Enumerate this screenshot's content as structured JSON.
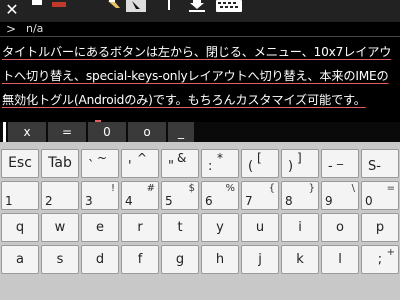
{
  "titlebar": {
    "close_glyph": "✕",
    "icons": [
      "close-icon",
      "menu-icon",
      "hand-icon",
      "cursor-icon",
      "vertical-bar-icon",
      "download-icon",
      "keyboard-icon"
    ]
  },
  "terminal": {
    "status_chevron": ">",
    "status_path": "n/a",
    "text": "タイトルバーにあるボタンは左から、閉じる、メニュー、10x7レイアウトへ切り替え、special-keys-onlyレイアウトへ切り替え、本来のIMEの無効化トグル(Androidのみ)です。もちろんカスタマイズ可能です。"
  },
  "candidates": [
    "x",
    "=",
    "0",
    "o",
    "_"
  ],
  "keyboard": {
    "row1": [
      {
        "main": "Esc"
      },
      {
        "main": "Tab"
      },
      {
        "lo": "`",
        "hi": "~"
      },
      {
        "lo": "'",
        "hi": "^"
      },
      {
        "lo": "\"",
        "hi": "&"
      },
      {
        "lo": ":",
        "hi": "*"
      },
      {
        "lo": "(",
        "hi": "["
      },
      {
        "lo": ")",
        "hi": "]"
      },
      {
        "lo": "-",
        "hi": "_"
      },
      {
        "lo": "S-",
        "hi": ""
      }
    ],
    "row2": [
      {
        "main": "1",
        "sub": ""
      },
      {
        "main": "2",
        "sub": ""
      },
      {
        "main": "3",
        "sub": "!"
      },
      {
        "main": "4",
        "sub": "#"
      },
      {
        "main": "5",
        "sub": "$"
      },
      {
        "main": "6",
        "sub": "%"
      },
      {
        "main": "7",
        "sub": "{"
      },
      {
        "main": "8",
        "sub": "}"
      },
      {
        "main": "9",
        "sub": "\\"
      },
      {
        "main": "0",
        "sub": "="
      }
    ],
    "row3": [
      "q",
      "w",
      "e",
      "r",
      "t",
      "y",
      "u",
      "i",
      "o",
      "p"
    ],
    "row4": [
      {
        "main": "a"
      },
      {
        "main": "s"
      },
      {
        "main": "d"
      },
      {
        "main": "f"
      },
      {
        "main": "g"
      },
      {
        "main": "h"
      },
      {
        "main": "j"
      },
      {
        "main": "k"
      },
      {
        "main": "l"
      },
      {
        "main": ";",
        "sub": "+"
      }
    ]
  }
}
